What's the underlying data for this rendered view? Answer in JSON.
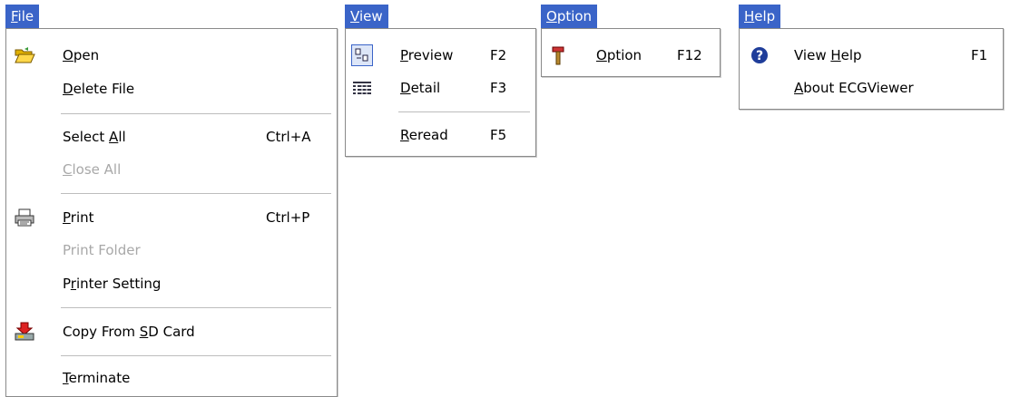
{
  "menus": {
    "file": {
      "title_mn": "F",
      "title_rest": "ile",
      "items": {
        "open": {
          "mn": "O",
          "rest": "pen"
        },
        "delete_file": {
          "mn": "D",
          "rest": "elete File"
        },
        "select_all": {
          "pre": "Select ",
          "mn": "A",
          "rest": "ll",
          "shortcut": "Ctrl+A"
        },
        "close_all": {
          "mn": "C",
          "rest": "lose All"
        },
        "print": {
          "mn": "P",
          "rest": "rint",
          "shortcut": "Ctrl+P"
        },
        "print_folder": {
          "text": "Print Folder"
        },
        "printer_setting": {
          "pre": "P",
          "mn": "r",
          "rest": "inter Setting"
        },
        "copy_sd": {
          "pre": "Copy From ",
          "mn": "S",
          "rest": "D Card"
        },
        "terminate": {
          "mn": "T",
          "rest": "erminate"
        }
      }
    },
    "view": {
      "title_mn": "V",
      "title_rest": "iew",
      "items": {
        "preview": {
          "mn": "P",
          "rest": "review",
          "shortcut": "F2"
        },
        "detail": {
          "mn": "D",
          "rest": "etail",
          "shortcut": "F3"
        },
        "reread": {
          "mn": "R",
          "rest": "eread",
          "shortcut": "F5"
        }
      }
    },
    "option": {
      "title_mn": "O",
      "title_rest": "ption",
      "items": {
        "option": {
          "mn": "O",
          "rest": "ption",
          "shortcut": "F12"
        }
      }
    },
    "help": {
      "title_mn": "H",
      "title_rest": "elp",
      "items": {
        "view_help": {
          "pre": "View ",
          "mn": "H",
          "rest": "elp",
          "shortcut": "F1"
        },
        "about": {
          "mn": "A",
          "rest": "bout ECGViewer"
        }
      }
    }
  },
  "colors": {
    "menu_title_bg": "#3a64c8",
    "disabled_text": "#a8a8a8"
  },
  "icons": [
    "folder-open-icon",
    "printer-icon",
    "sd-card-download-icon",
    "preview-icon",
    "detail-list-icon",
    "hammer-icon",
    "help-question-icon"
  ]
}
